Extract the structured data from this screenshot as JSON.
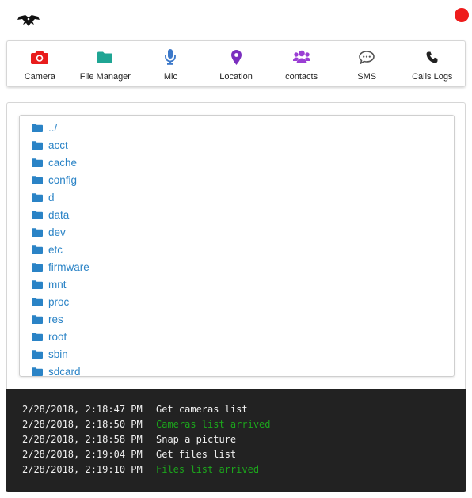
{
  "colors": {
    "accent_red": "#e81c1c",
    "tool_teal": "#1fa594",
    "tool_blue": "#3b78c9",
    "tool_purple": "#7b2fbf",
    "tool_violet": "#9b3fd4",
    "success_green": "#1ca51c",
    "console_bg": "#222222",
    "link_blue": "#2a83c6"
  },
  "header": {
    "logo_icon": "raven-logo-icon",
    "status_icon": "status-dot-icon"
  },
  "toolbar": {
    "items": [
      {
        "label": "Camera",
        "icon": "camera-icon"
      },
      {
        "label": "File Manager",
        "icon": "folder-icon"
      },
      {
        "label": "Mic",
        "icon": "microphone-icon"
      },
      {
        "label": "Location",
        "icon": "map-marker-icon"
      },
      {
        "label": "contacts",
        "icon": "users-icon"
      },
      {
        "label": "SMS",
        "icon": "comment-icon"
      },
      {
        "label": "Calls Logs",
        "icon": "phone-icon"
      }
    ]
  },
  "files": {
    "items": [
      "../",
      "acct",
      "cache",
      "config",
      "d",
      "data",
      "dev",
      "etc",
      "firmware",
      "mnt",
      "proc",
      "res",
      "root",
      "sbin",
      "sdcard"
    ]
  },
  "console": {
    "logs": [
      {
        "time": "2/28/2018, 2:18:47 PM",
        "message": "Get cameras list",
        "status": "normal"
      },
      {
        "time": "2/28/2018, 2:18:50 PM",
        "message": "Cameras list arrived",
        "status": "success"
      },
      {
        "time": "2/28/2018, 2:18:58 PM",
        "message": "Snap a picture",
        "status": "normal"
      },
      {
        "time": "2/28/2018, 2:19:04 PM",
        "message": "Get files list",
        "status": "normal"
      },
      {
        "time": "2/28/2018, 2:19:10 PM",
        "message": "Files list arrived",
        "status": "success"
      }
    ]
  }
}
